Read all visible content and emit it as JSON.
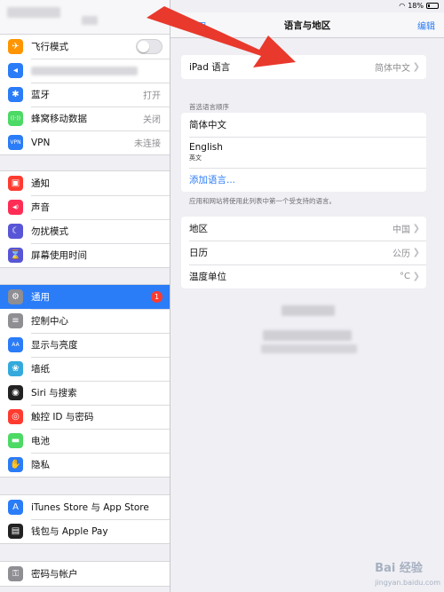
{
  "sidebar": {
    "group1": [
      {
        "label": "飞行模式",
        "value": "",
        "color": "#ff9500",
        "icon": "airplane-icon",
        "glyph": "✈",
        "control": "toggle"
      },
      {
        "label": "",
        "value": "",
        "color": "#2b7cf7",
        "icon": "wifi-icon",
        "glyph": "◂",
        "blurred": true
      },
      {
        "label": "蓝牙",
        "value": "打开",
        "color": "#2b7cf7",
        "icon": "bluetooth-icon",
        "glyph": "✱"
      },
      {
        "label": "蜂窝移动数据",
        "value": "关闭",
        "color": "#4cd964",
        "icon": "cellular-icon",
        "glyph": "((·))"
      },
      {
        "label": "VPN",
        "value": "未连接",
        "color": "#2b7cf7",
        "icon": "vpn-icon",
        "glyph": "VPN"
      }
    ],
    "group2": [
      {
        "label": "通知",
        "color": "#ff3b30",
        "icon": "notifications-icon",
        "glyph": "▣"
      },
      {
        "label": "声音",
        "color": "#ff2d55",
        "icon": "sound-icon",
        "glyph": "◀)"
      },
      {
        "label": "勿扰模式",
        "color": "#5856d6",
        "icon": "moon-icon",
        "glyph": "☾"
      },
      {
        "label": "屏幕使用时间",
        "color": "#5856d6",
        "icon": "hourglass-icon",
        "glyph": "⌛"
      }
    ],
    "group3": [
      {
        "label": "通用",
        "color": "#8e8e93",
        "icon": "gear-icon",
        "glyph": "⚙",
        "selected": true,
        "badge": "1"
      },
      {
        "label": "控制中心",
        "color": "#8e8e93",
        "icon": "control-center-icon",
        "glyph": "≡"
      },
      {
        "label": "显示与亮度",
        "color": "#2b7cf7",
        "icon": "display-icon",
        "glyph": "AA"
      },
      {
        "label": "墙纸",
        "color": "#34aadc",
        "icon": "wallpaper-icon",
        "glyph": "❀"
      },
      {
        "label": "Siri 与搜索",
        "color": "#222222",
        "icon": "siri-icon",
        "glyph": "◉"
      },
      {
        "label": "触控 ID 与密码",
        "color": "#ff3b30",
        "icon": "fingerprint-icon",
        "glyph": "◎"
      },
      {
        "label": "电池",
        "color": "#4cd964",
        "icon": "battery-icon",
        "glyph": "▬"
      },
      {
        "label": "隐私",
        "color": "#2b7cf7",
        "icon": "hand-icon",
        "glyph": "✋"
      }
    ],
    "group4": [
      {
        "label": "iTunes Store 与 App Store",
        "color": "#2b7cf7",
        "icon": "app-store-icon",
        "glyph": "A"
      },
      {
        "label": "钱包与 Apple Pay",
        "color": "#222222",
        "icon": "wallet-icon",
        "glyph": "▤"
      }
    ],
    "group5": [
      {
        "label": "密码与帐户",
        "color": "#8e8e93",
        "icon": "key-icon",
        "glyph": "⚿"
      }
    ]
  },
  "status": {
    "battery": "18%"
  },
  "nav": {
    "back": "通用",
    "title": "语言与地区",
    "edit": "编辑"
  },
  "ipad_language": {
    "label": "iPad 语言",
    "value": "简体中文"
  },
  "preferred": {
    "header": "首选语言顺序",
    "items": [
      {
        "label": "简体中文",
        "sub": ""
      },
      {
        "label": "English",
        "sub": "英文"
      }
    ],
    "add": "添加语言...",
    "footer": "应用和网站将使用此列表中第一个受支持的语言。"
  },
  "region_group": [
    {
      "label": "地区",
      "value": "中国"
    },
    {
      "label": "日历",
      "value": "公历"
    },
    {
      "label": "温度单位",
      "value": "°C"
    }
  ],
  "watermark": {
    "main": "Bai 经验",
    "sub": "jingyan.baidu.com"
  }
}
